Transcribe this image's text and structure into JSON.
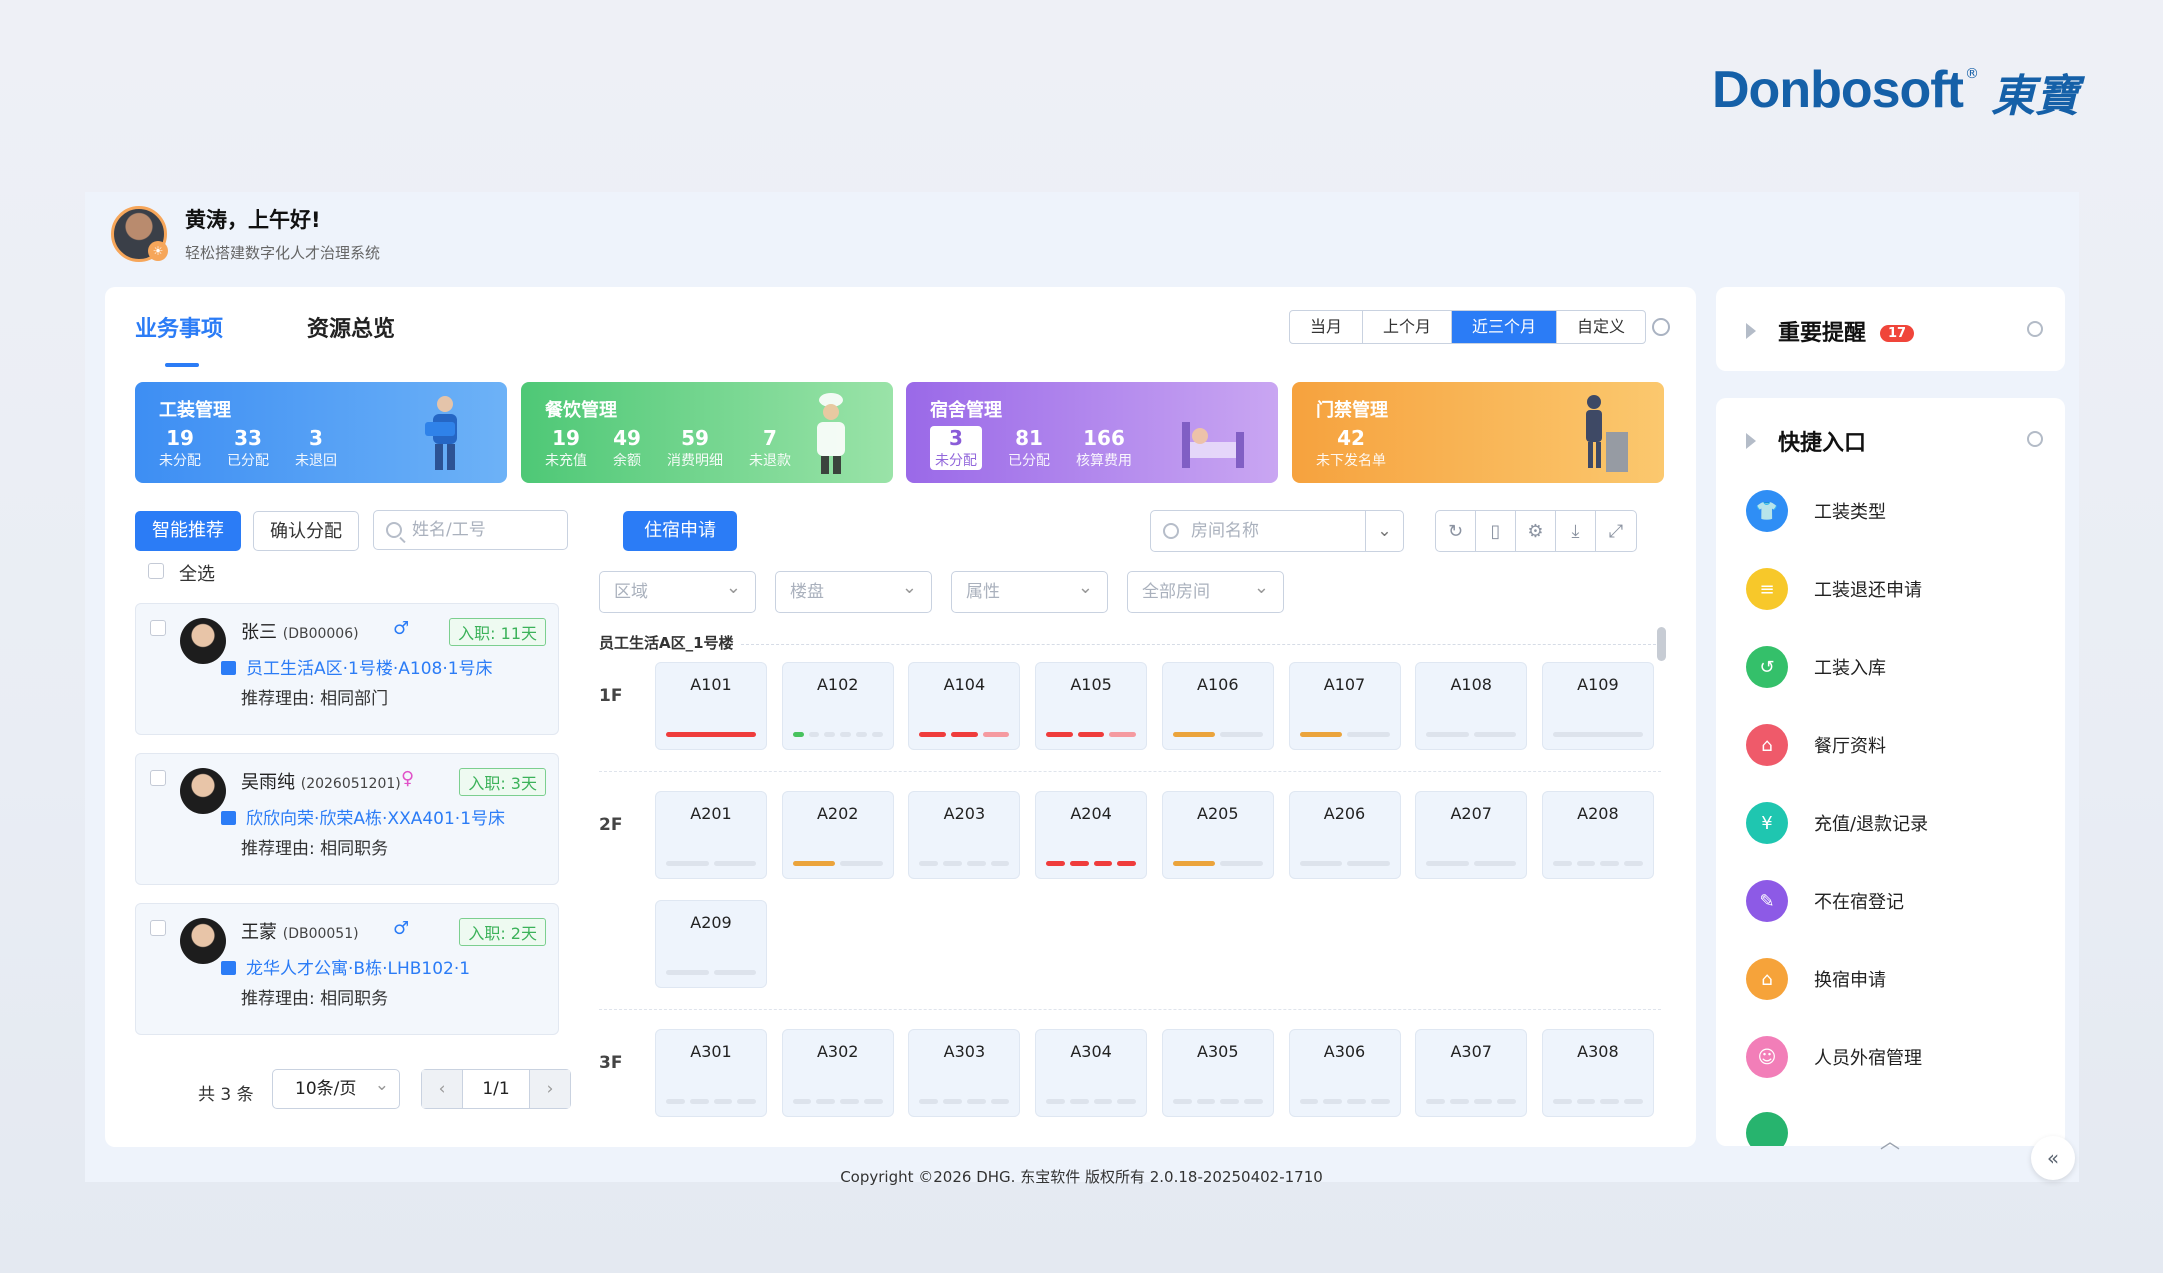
{
  "logo": {
    "brand": "Donbosoft",
    "reg": "®",
    "cn": "東寶"
  },
  "user": {
    "greeting": "黄涛，上午好!",
    "slogan": "轻松搭建数字化人才治理系统"
  },
  "tabs": [
    {
      "label": "业务事项",
      "active": true
    },
    {
      "label": "资源总览",
      "active": false
    }
  ],
  "period": {
    "options": [
      "当月",
      "上个月",
      "近三个月",
      "自定义"
    ],
    "selected": "近三个月"
  },
  "cards": [
    {
      "title": "工装管理",
      "stats": [
        {
          "value": "19",
          "label": "未分配"
        },
        {
          "value": "33",
          "label": "已分配"
        },
        {
          "value": "3",
          "label": "未退回"
        }
      ]
    },
    {
      "title": "餐饮管理",
      "stats": [
        {
          "value": "19",
          "label": "未充值"
        },
        {
          "value": "49",
          "label": "余额"
        },
        {
          "value": "59",
          "label": "消费明细"
        },
        {
          "value": "7",
          "label": "未退款"
        }
      ]
    },
    {
      "title": "宿舍管理",
      "stats": [
        {
          "value": "3",
          "label": "未分配"
        },
        {
          "value": "81",
          "label": "已分配"
        },
        {
          "value": "166",
          "label": "核算费用"
        }
      ]
    },
    {
      "title": "门禁管理",
      "stats": [
        {
          "value": "42",
          "label": "未下发名单"
        }
      ]
    }
  ],
  "left": {
    "smart_btn": "智能推荐",
    "confirm_btn": "确认分配",
    "search_placeholder": "姓名/工号",
    "select_all": "全选",
    "employees": [
      {
        "name": "张三",
        "code": "(DB00006)",
        "sex": "♂",
        "badge": "入职: 11天",
        "location": "员工生活A区·1号楼·A108·1号床",
        "reason": "推荐理由: 相同部门"
      },
      {
        "name": "吴雨纯",
        "code": "(2026051201)",
        "sex": "♀",
        "badge": "入职: 3天",
        "location": "欣欣向荣·欣荣A栋·XXA401·1号床",
        "reason": "推荐理由: 相同职务"
      },
      {
        "name": "王蒙",
        "code": "(DB00051)",
        "sex": "♂",
        "badge": "入职: 2天",
        "location": "龙华人才公寓·B栋·LHB102·1",
        "reason": "推荐理由: 相同职务"
      }
    ],
    "pager": {
      "total": "共 3 条",
      "size": "10条/页",
      "page": "1/1",
      "prev": "‹",
      "next": "›"
    }
  },
  "rooms": {
    "apply_btn": "住宿申请",
    "search_placeholder": "房间名称",
    "filters": [
      "区域",
      "楼盘",
      "属性",
      "全部房间"
    ],
    "building": "员工生活A区_1号楼",
    "floors": [
      {
        "label": "1F",
        "rooms": [
          {
            "name": "A101",
            "bars": [
              "#ef3c3c"
            ]
          },
          {
            "name": "A102",
            "bars": [
              "#48c25e",
              "#dde3ec",
              "#dde3ec",
              "#dde3ec",
              "#dde3ec",
              "#dde3ec"
            ]
          },
          {
            "name": "A104",
            "bars": [
              "#ef3c3c",
              "#ef3c3c",
              "#f59aa0"
            ]
          },
          {
            "name": "A105",
            "bars": [
              "#ef3c3c",
              "#ef3c3c",
              "#f59aa0"
            ]
          },
          {
            "name": "A106",
            "bars": [
              "#eba43c",
              "#dde3ec"
            ]
          },
          {
            "name": "A107",
            "bars": [
              "#eba43c",
              "#dde3ec"
            ]
          },
          {
            "name": "A108",
            "bars": [
              "#dde3ec",
              "#dde3ec"
            ]
          },
          {
            "name": "A109",
            "bars": [
              "#dde3ec"
            ]
          }
        ]
      },
      {
        "label": "2F",
        "rooms": [
          {
            "name": "A201",
            "bars": [
              "#dde3ec",
              "#dde3ec"
            ]
          },
          {
            "name": "A202",
            "bars": [
              "#eba43c",
              "#dde3ec"
            ]
          },
          {
            "name": "A203",
            "bars": [
              "#dde3ec",
              "#dde3ec",
              "#dde3ec",
              "#dde3ec"
            ]
          },
          {
            "name": "A204",
            "bars": [
              "#ef3c3c",
              "#ef3c3c",
              "#ef3c3c",
              "#ef3c3c"
            ]
          },
          {
            "name": "A205",
            "bars": [
              "#eba43c",
              "#dde3ec"
            ]
          },
          {
            "name": "A206",
            "bars": [
              "#dde3ec",
              "#dde3ec"
            ]
          },
          {
            "name": "A207",
            "bars": [
              "#dde3ec",
              "#dde3ec"
            ]
          },
          {
            "name": "A208",
            "bars": [
              "#dde3ec",
              "#dde3ec",
              "#dde3ec",
              "#dde3ec"
            ]
          },
          {
            "name": "A209",
            "bars": [
              "#dde3ec",
              "#dde3ec"
            ]
          }
        ]
      },
      {
        "label": "3F",
        "rooms": [
          {
            "name": "A301",
            "bars": [
              "#dde3ec",
              "#dde3ec",
              "#dde3ec",
              "#dde3ec"
            ]
          },
          {
            "name": "A302",
            "bars": [
              "#dde3ec",
              "#dde3ec",
              "#dde3ec",
              "#dde3ec"
            ]
          },
          {
            "name": "A303",
            "bars": [
              "#dde3ec",
              "#dde3ec",
              "#dde3ec",
              "#dde3ec"
            ]
          },
          {
            "name": "A304",
            "bars": [
              "#dde3ec",
              "#dde3ec",
              "#dde3ec",
              "#dde3ec"
            ]
          },
          {
            "name": "A305",
            "bars": [
              "#dde3ec",
              "#dde3ec",
              "#dde3ec",
              "#dde3ec"
            ]
          },
          {
            "name": "A306",
            "bars": [
              "#dde3ec",
              "#dde3ec",
              "#dde3ec",
              "#dde3ec"
            ]
          },
          {
            "name": "A307",
            "bars": [
              "#dde3ec",
              "#dde3ec",
              "#dde3ec",
              "#dde3ec"
            ]
          },
          {
            "name": "A308",
            "bars": [
              "#dde3ec",
              "#dde3ec",
              "#dde3ec",
              "#dde3ec"
            ]
          }
        ]
      }
    ]
  },
  "reminder": {
    "title": "重要提醒",
    "count": "17"
  },
  "quick": {
    "title": "快捷入口",
    "items": [
      {
        "label": "工装类型",
        "color": "#2f8ef5",
        "icon": "shirt-icon",
        "glyph": "👕"
      },
      {
        "label": "工装退还申请",
        "color": "#f7c82a",
        "icon": "list-icon",
        "glyph": "≡"
      },
      {
        "label": "工装入库",
        "color": "#34c06a",
        "icon": "return-icon",
        "glyph": "↺"
      },
      {
        "label": "餐厅资料",
        "color": "#ef5a6a",
        "icon": "dish-icon",
        "glyph": "⌂"
      },
      {
        "label": "充值/退款记录",
        "color": "#1fc6b0",
        "icon": "yuan-icon",
        "glyph": "¥"
      },
      {
        "label": "不在宿登记",
        "color": "#8d5ae6",
        "icon": "form-icon",
        "glyph": "✎"
      },
      {
        "label": "换宿申请",
        "color": "#f6a33a",
        "icon": "house-icon",
        "glyph": "⌂"
      },
      {
        "label": "人员外宿管理",
        "color": "#f27eb8",
        "icon": "people-icon",
        "glyph": "☺"
      }
    ]
  },
  "footer": "Copyright ©2026 DHG. 东宝软件 版权所有 2.0.18-20250402-1710"
}
